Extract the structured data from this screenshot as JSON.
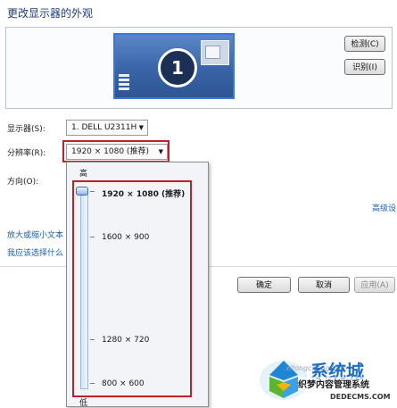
{
  "window": {
    "title": "更改显示器的外观"
  },
  "preview": {
    "monitor_number": "1"
  },
  "buttons": {
    "detect": "检测(C)",
    "identify": "识别(I)",
    "ok": "确定",
    "cancel": "取消",
    "apply": "应用(A)"
  },
  "settings": {
    "display_label": "显示器(S):",
    "display_value": "1. DELL U2311H",
    "resolution_label": "分辨率(R):",
    "resolution_value": "1920 × 1080 (推荐)",
    "orientation_label": "方向(O):",
    "advanced_link": "高级设"
  },
  "links": {
    "text_size": "放大或缩小文本",
    "which_setting": "我应该选择什么"
  },
  "dropdown": {
    "high_label": "高",
    "low_label": "低",
    "selected_fraction": 1.0,
    "options": [
      {
        "label": "1920 × 1080 (推荐)"
      },
      {
        "label": "1600 × 900"
      },
      {
        "label": "1280 × 720"
      },
      {
        "label": "800 × 600"
      }
    ]
  },
  "watermark": {
    "brand": "系统城",
    "tagline": "织梦内容管理系统",
    "domain": "DEDECMS.COM",
    "site": "xitongcheng.com"
  },
  "colors": {
    "accent_blue": "#3d78d8",
    "highlight_red": "#c0202a",
    "link": "#1c5fb0"
  }
}
